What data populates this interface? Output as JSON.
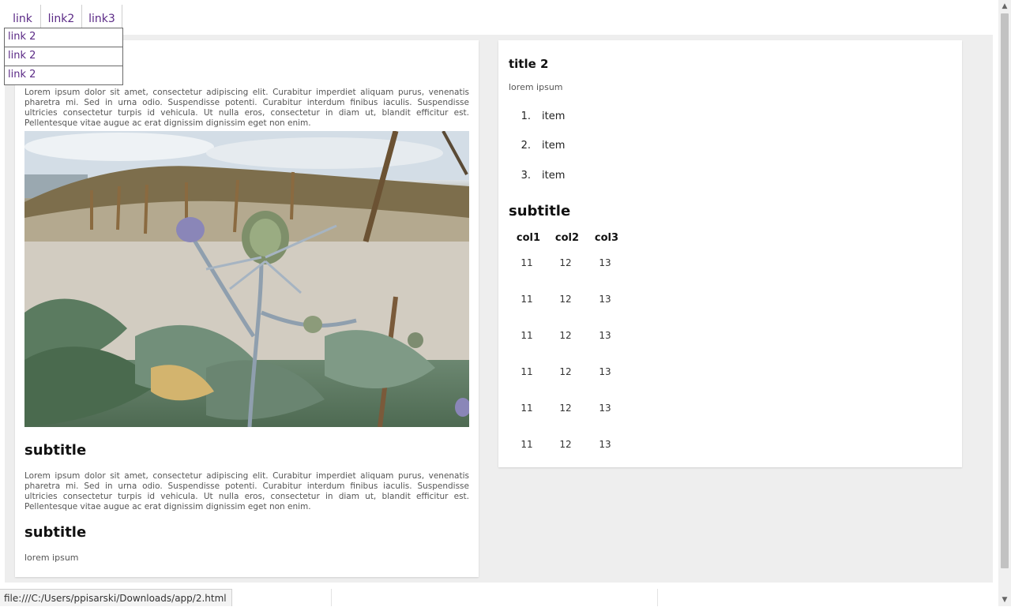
{
  "nav": {
    "links": [
      "link",
      "link2",
      "link3"
    ],
    "dropdown": [
      "link 2",
      "link 2",
      "link 2"
    ]
  },
  "left_card": {
    "paragraph1": "Lorem ipsum dolor sit amet, consectetur adipiscing elit. Curabitur imperdiet aliquam purus, venenatis pharetra mi. Sed in urna odio. Suspendisse potenti. Curabitur interdum finibus iaculis. Suspendisse ultricies consectetur turpis id vehicula. Ut nulla eros, consectetur in diam ut, blandit efficitur est. Pellentesque vitae augue ac erat dignissim dignissim eget non enim.",
    "subtitle1": "subtitle",
    "paragraph2": "Lorem ipsum dolor sit amet, consectetur adipiscing elit. Curabitur imperdiet aliquam purus, venenatis pharetra mi. Sed in urna odio. Suspendisse potenti. Curabitur interdum finibus iaculis. Suspendisse ultricies consectetur turpis id vehicula. Ut nulla eros, consectetur in diam ut, blandit efficitur est. Pellentesque vitae augue ac erat dignissim dignissim eget non enim.",
    "subtitle2": "subtitle",
    "caption": "lorem ipsum"
  },
  "right_card": {
    "title": "title 2",
    "caption": "lorem ipsum",
    "list": [
      {
        "num": "1.",
        "text": "item"
      },
      {
        "num": "2.",
        "text": "item"
      },
      {
        "num": "3.",
        "text": "item"
      }
    ],
    "subtitle": "subtitle",
    "table": {
      "headers": [
        "col1",
        "col2",
        "col3"
      ],
      "rows": [
        [
          "11",
          "12",
          "13"
        ],
        [
          "11",
          "12",
          "13"
        ],
        [
          "11",
          "12",
          "13"
        ],
        [
          "11",
          "12",
          "13"
        ],
        [
          "11",
          "12",
          "13"
        ],
        [
          "11",
          "12",
          "13"
        ]
      ]
    }
  },
  "status_bar": {
    "url": "file:///C:/Users/ppisarski/Downloads/app/2.html"
  }
}
